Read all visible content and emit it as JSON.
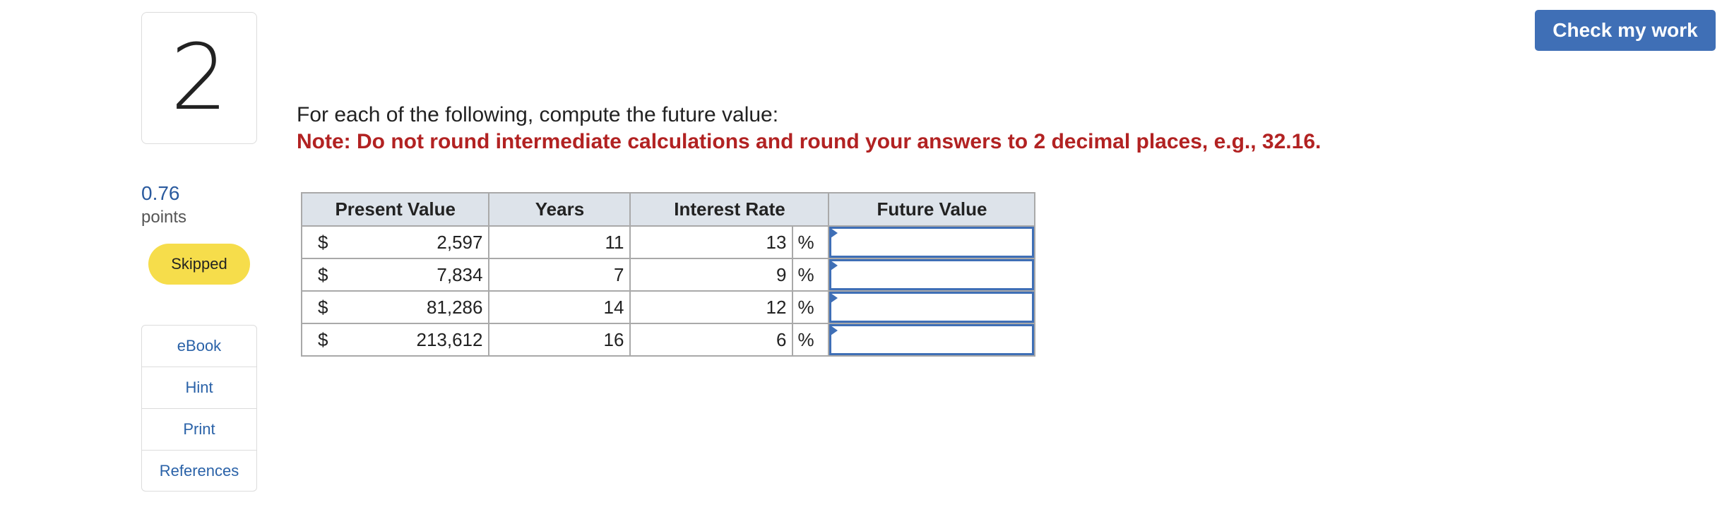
{
  "question": {
    "number": "2",
    "points_value": "0.76",
    "points_label": "points",
    "status": "Skipped"
  },
  "tools": [
    {
      "label": "eBook"
    },
    {
      "label": "Hint"
    },
    {
      "label": "Print"
    },
    {
      "label": "References"
    }
  ],
  "actions": {
    "check_label": "Check my work"
  },
  "prompt": {
    "text": "For each of the following, compute the future value:",
    "note": "Note: Do not round intermediate calculations and round your answers to 2 decimal places, e.g., 32.16."
  },
  "table": {
    "headers": [
      "Present Value",
      "Years",
      "Interest Rate",
      "Future Value"
    ],
    "rows": [
      {
        "currency": "$",
        "present_value": "2,597",
        "years": "11",
        "rate": "13",
        "percent": "%",
        "future_value": ""
      },
      {
        "currency": "$",
        "present_value": "7,834",
        "years": "7",
        "rate": "9",
        "percent": "%",
        "future_value": ""
      },
      {
        "currency": "$",
        "present_value": "81,286",
        "years": "14",
        "rate": "12",
        "percent": "%",
        "future_value": ""
      },
      {
        "currency": "$",
        "present_value": "213,612",
        "years": "16",
        "rate": "6",
        "percent": "%",
        "future_value": ""
      }
    ]
  },
  "colors": {
    "accent": "#3f6fb6",
    "note": "#b22222",
    "skipped_badge": "#f6dd4b",
    "header_bg": "#dde3ea"
  }
}
